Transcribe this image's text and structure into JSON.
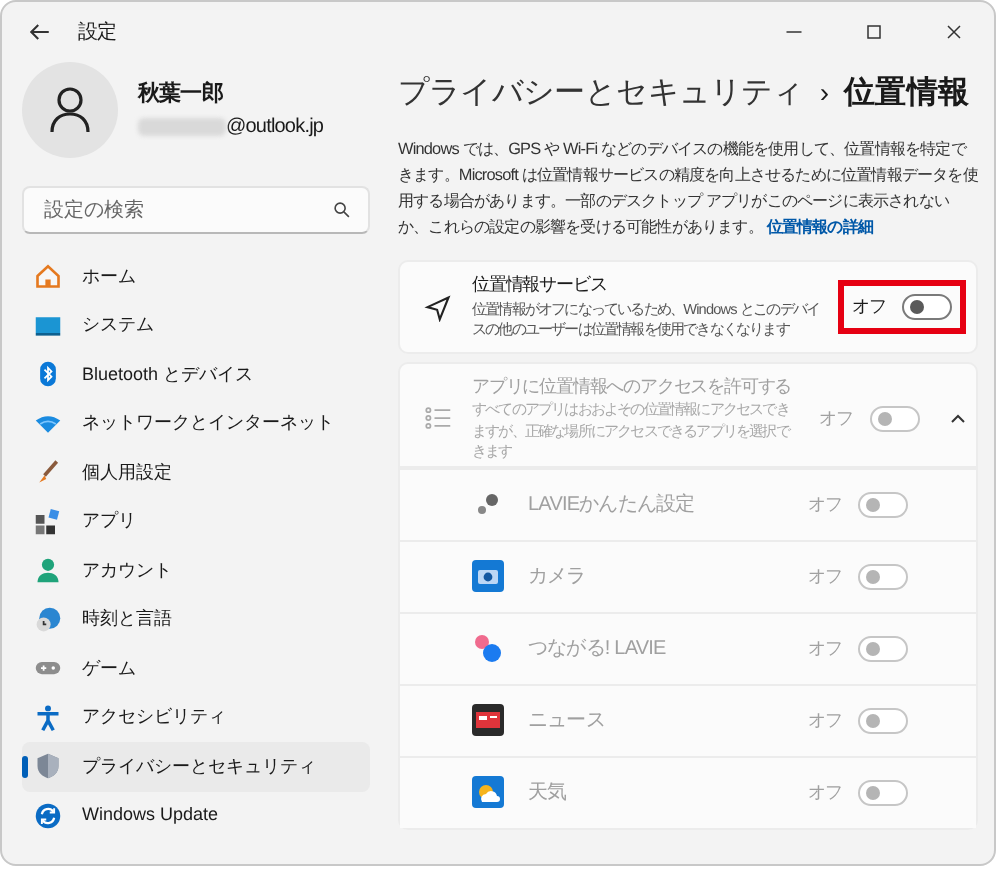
{
  "window": {
    "title": "設定"
  },
  "account": {
    "name": "秋葉一郎",
    "email": "@outlook.jp",
    "email_redacted": true
  },
  "search": {
    "placeholder": "設定の検索"
  },
  "sidebar": {
    "items": [
      {
        "label": "ホーム",
        "selected": false
      },
      {
        "label": "システム",
        "selected": false
      },
      {
        "label": "Bluetooth とデバイス",
        "selected": false
      },
      {
        "label": "ネットワークとインターネット",
        "selected": false
      },
      {
        "label": "個人用設定",
        "selected": false
      },
      {
        "label": "アプリ",
        "selected": false
      },
      {
        "label": "アカウント",
        "selected": false
      },
      {
        "label": "時刻と言語",
        "selected": false
      },
      {
        "label": "ゲーム",
        "selected": false
      },
      {
        "label": "アクセシビリティ",
        "selected": false
      },
      {
        "label": "プライバシーとセキュリティ",
        "selected": true
      },
      {
        "label": "Windows Update",
        "selected": false
      }
    ]
  },
  "breadcrumb": {
    "parent": "プライバシーとセキュリティ",
    "separator": "›",
    "current": "位置情報"
  },
  "description": {
    "text": "Windows では、GPS や Wi-Fi などのデバイスの機能を使用して、位置情報を特定できます。Microsoft は位置情報サービスの精度を向上させるために位置情報データを使用する場合があります。一部のデスクトップ アプリがこのページに表示されないか、これらの設定の影響を受ける可能性があります。",
    "link": "位置情報の詳細"
  },
  "location_service": {
    "title": "位置情報サービス",
    "description": "位置情報がオフになっているため、Windows とこのデバイスの他のユーザーは位置情報を使用できなくなります",
    "state_label": "オフ",
    "on": false,
    "highlighted": true
  },
  "app_access": {
    "title": "アプリに位置情報へのアクセスを許可する",
    "description": "すべてのアプリはおおよその位置情報にアクセスできますが、正確な場所にアクセスできるアプリを選択できます",
    "state_label": "オフ",
    "on": false,
    "disabled": true,
    "expanded": true
  },
  "apps": [
    {
      "name": "LAVIEかんたん設定",
      "state_label": "オフ",
      "on": false,
      "disabled": true
    },
    {
      "name": "カメラ",
      "state_label": "オフ",
      "on": false,
      "disabled": true
    },
    {
      "name": "つながる! LAVIE",
      "state_label": "オフ",
      "on": false,
      "disabled": true
    },
    {
      "name": "ニュース",
      "state_label": "オフ",
      "on": false,
      "disabled": true
    },
    {
      "name": "天気",
      "state_label": "オフ",
      "on": false,
      "disabled": true
    }
  ]
}
